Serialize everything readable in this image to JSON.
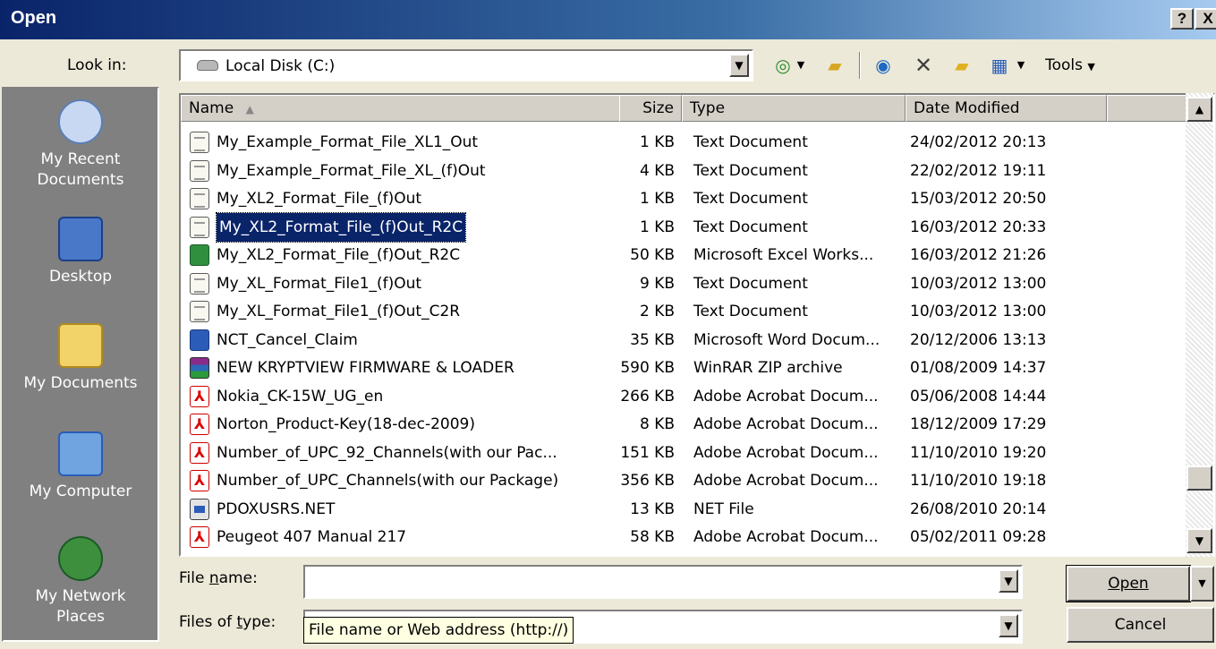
{
  "window": {
    "title": "Open",
    "help_button": "?",
    "close_button": "X"
  },
  "look_in": {
    "label": "Look in:",
    "value": "Local Disk (C:)"
  },
  "toolbar": {
    "tools_label": "Tools"
  },
  "places": [
    {
      "label": "My Recent Documents",
      "icon": "recent-documents-icon",
      "color": "#c9d8f2"
    },
    {
      "label": "Desktop",
      "icon": "desktop-icon",
      "color": "#4a78c8"
    },
    {
      "label": "My Documents",
      "icon": "folder-icon",
      "color": "#f2d36a"
    },
    {
      "label": "My Computer",
      "icon": "computer-icon",
      "color": "#6fa4e0"
    },
    {
      "label": "My Network Places",
      "icon": "network-icon",
      "color": "#3d8f3d"
    }
  ],
  "columns": {
    "name": "Name",
    "size": "Size",
    "type": "Type",
    "date": "Date Modified"
  },
  "files": [
    {
      "name": "My_Example_Format_File_XL1_Out",
      "size": "1 KB",
      "type": "Text Document",
      "date": "24/02/2012 20:13",
      "icon": "ic-txt"
    },
    {
      "name": "My_Example_Format_File_XL_(f)Out",
      "size": "4 KB",
      "type": "Text Document",
      "date": "22/02/2012 19:11",
      "icon": "ic-txt"
    },
    {
      "name": "My_XL2_Format_File_(f)Out",
      "size": "1 KB",
      "type": "Text Document",
      "date": "15/03/2012 20:50",
      "icon": "ic-txt"
    },
    {
      "name": "My_XL2_Format_File_(f)Out_R2C",
      "size": "1 KB",
      "type": "Text Document",
      "date": "16/03/2012 20:33",
      "icon": "ic-txt",
      "selected": true
    },
    {
      "name": "My_XL2_Format_File_(f)Out_R2C",
      "size": "50 KB",
      "type": "Microsoft Excel Works...",
      "date": "16/03/2012 21:26",
      "icon": "ic-xls"
    },
    {
      "name": "My_XL_Format_File1_(f)Out",
      "size": "9 KB",
      "type": "Text Document",
      "date": "10/03/2012 13:00",
      "icon": "ic-txt"
    },
    {
      "name": "My_XL_Format_File1_(f)Out_C2R",
      "size": "2 KB",
      "type": "Text Document",
      "date": "10/03/2012 13:00",
      "icon": "ic-txt"
    },
    {
      "name": "NCT_Cancel_Claim",
      "size": "35 KB",
      "type": "Microsoft Word Docum...",
      "date": "20/12/2006 13:13",
      "icon": "ic-doc"
    },
    {
      "name": "NEW KRYPTVIEW FIRMWARE & LOADER",
      "size": "590 KB",
      "type": "WinRAR ZIP archive",
      "date": "01/08/2009 14:37",
      "icon": "ic-rar"
    },
    {
      "name": "Nokia_CK-15W_UG_en",
      "size": "266 KB",
      "type": "Adobe Acrobat Docum...",
      "date": "05/06/2008 14:44",
      "icon": "ic-pdf"
    },
    {
      "name": "Norton_Product-Key(18-dec-2009)",
      "size": "8 KB",
      "type": "Adobe Acrobat Docum...",
      "date": "18/12/2009 17:29",
      "icon": "ic-pdf"
    },
    {
      "name": "Number_of_UPC_92_Channels(with our Pac...",
      "size": "151 KB",
      "type": "Adobe Acrobat Docum...",
      "date": "11/10/2010 19:20",
      "icon": "ic-pdf"
    },
    {
      "name": "Number_of_UPC_Channels(with our Package)",
      "size": "356 KB",
      "type": "Adobe Acrobat Docum...",
      "date": "11/10/2010 19:18",
      "icon": "ic-pdf"
    },
    {
      "name": "PDOXUSRS.NET",
      "size": "13 KB",
      "type": "NET File",
      "date": "26/08/2010 20:14",
      "icon": "ic-net"
    },
    {
      "name": "Peugeot 407 Manual 217",
      "size": "58 KB",
      "type": "Adobe Acrobat Docum...",
      "date": "05/02/2011 09:28",
      "icon": "ic-pdf"
    }
  ],
  "file_name": {
    "label": "File name:",
    "value": ""
  },
  "file_type": {
    "label": "Files of type:",
    "tooltip": "File name or Web address (http://)"
  },
  "buttons": {
    "open": "Open",
    "cancel": "Cancel"
  }
}
